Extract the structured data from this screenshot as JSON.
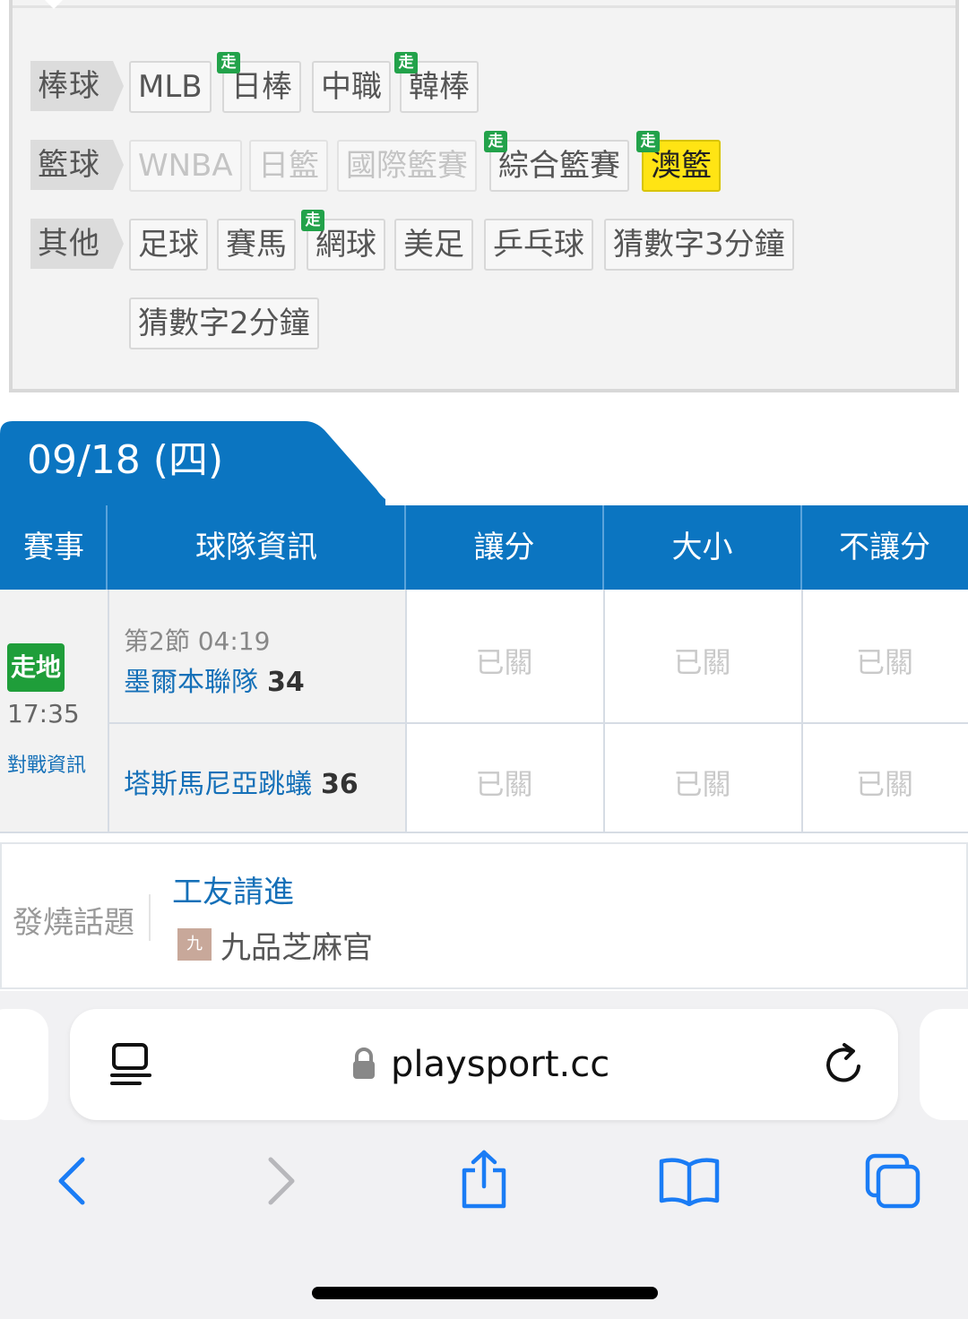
{
  "categories": [
    {
      "label": "棒球",
      "items": [
        {
          "name": "MLB",
          "live": false,
          "state": "normal"
        },
        {
          "name": "日棒",
          "live": true,
          "state": "normal"
        },
        {
          "name": "中職",
          "live": false,
          "state": "normal"
        },
        {
          "name": "韓棒",
          "live": true,
          "state": "normal"
        }
      ]
    },
    {
      "label": "籃球",
      "items": [
        {
          "name": "WNBA",
          "live": false,
          "state": "disabled"
        },
        {
          "name": "日籃",
          "live": false,
          "state": "disabled"
        },
        {
          "name": "國際籃賽",
          "live": false,
          "state": "disabled"
        },
        {
          "name": "綜合籃賽",
          "live": true,
          "state": "normal"
        },
        {
          "name": "澳籃",
          "live": true,
          "state": "active"
        }
      ]
    },
    {
      "label": "其他",
      "items": [
        {
          "name": "足球",
          "live": false,
          "state": "normal"
        },
        {
          "name": "賽馬",
          "live": false,
          "state": "normal"
        },
        {
          "name": "網球",
          "live": true,
          "state": "normal"
        },
        {
          "name": "美足",
          "live": false,
          "state": "normal"
        },
        {
          "name": "乒乓球",
          "live": false,
          "state": "normal"
        },
        {
          "name": "猜數字3分鐘",
          "live": false,
          "state": "normal"
        },
        {
          "name": "猜數字2分鐘",
          "live": false,
          "state": "normal"
        }
      ]
    }
  ],
  "live_badge": "走",
  "date_header": "09/18 (四)",
  "table": {
    "headers": [
      "賽事",
      "球隊資訊",
      "讓分",
      "大小",
      "不讓分"
    ],
    "game": {
      "live_label": "走地",
      "time": "17:35",
      "h2h_link": "對戰資訊",
      "period": "第2節 04:19",
      "home": {
        "name": "墨爾本聯隊",
        "score": "34"
      },
      "away": {
        "name": "塔斯馬尼亞跳蟻",
        "score": "36"
      },
      "closed_label": "已關"
    }
  },
  "hot_topics": {
    "label": "發燒話題",
    "title": "工友請進",
    "avatar_char": "九",
    "author": "九品芝麻官"
  },
  "browser": {
    "url": "playsport.cc",
    "icons": [
      "tab-overview-icon",
      "lock-icon",
      "reload-icon",
      "back-icon",
      "forward-icon",
      "share-icon",
      "bookmarks-icon",
      "tabs-icon"
    ]
  },
  "colors": {
    "primary_blue": "#0b75c1",
    "live_green": "#1f9e3a",
    "active_yellow": "#ffe414",
    "ios_blue": "#1a7cf5"
  }
}
